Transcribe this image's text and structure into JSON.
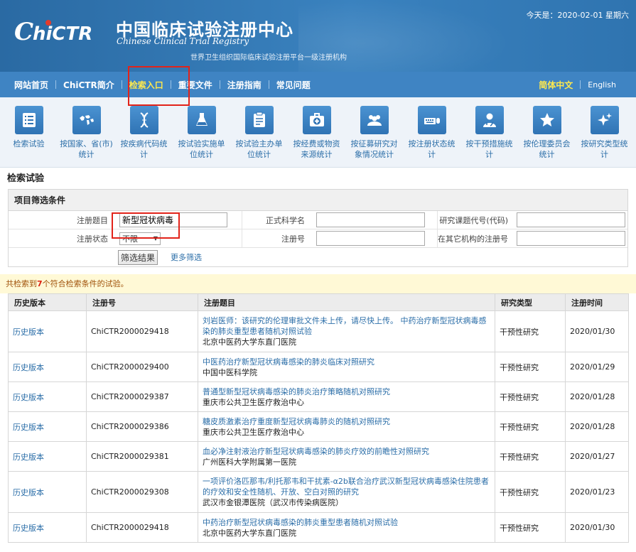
{
  "header": {
    "logo_text": "ChiCTR",
    "title_cn": "中国临床试验注册中心",
    "title_en": "Chinese Clinical Trial Registry",
    "tagline": "世界卫生组织国际临床试验注册平台一级注册机构",
    "today": "今天是：2020-02-01 星期六"
  },
  "nav": {
    "items": [
      "网站首页",
      "ChiCTR简介",
      "检索入口",
      "重要文件",
      "注册指南",
      "常见问题"
    ],
    "active_index": 2,
    "lang_cn": "简体中文",
    "lang_en": "English"
  },
  "icons": [
    {
      "label": "检索试验",
      "icon": "list-icon"
    },
    {
      "label": "按国家、省(市)统计",
      "icon": "world-map-icon"
    },
    {
      "label": "按疾病代码统计",
      "icon": "dna-icon"
    },
    {
      "label": "按试验实施单位统计",
      "icon": "flask-icon"
    },
    {
      "label": "按试验主办单位统计",
      "icon": "clipboard-icon"
    },
    {
      "label": "按经费或物资来源统计",
      "icon": "medical-kit-icon"
    },
    {
      "label": "按征募研究对象情况统计",
      "icon": "people-icon"
    },
    {
      "label": "按注册状态统计",
      "icon": "keyboard-mouse-icon"
    },
    {
      "label": "按干预措施统计",
      "icon": "doctor-icon"
    },
    {
      "label": "按伦理委员会统计",
      "icon": "star-icon"
    },
    {
      "label": "按研究类型统计",
      "icon": "sparkle-icon"
    }
  ],
  "search": {
    "section_title": "检索试验",
    "filter_title": "项目筛选条件",
    "fields": {
      "reg_title_label": "注册题目",
      "reg_title_value": "新型冠状病毒",
      "sci_name_label": "正式科学名",
      "sci_name_value": "",
      "code_label": "研究课题代号(代码)",
      "code_value": "",
      "status_label": "注册状态",
      "status_value": "不限",
      "regno_label": "注册号",
      "regno_value": "",
      "other_regno_label": "在其它机构的注册号",
      "other_regno_value": ""
    },
    "submit": "筛选结果",
    "more": "更多筛选"
  },
  "notice": {
    "prefix": "共检索到",
    "count": "7",
    "suffix": "个符合检索条件的试验。"
  },
  "table": {
    "headers": [
      "历史版本",
      "注册号",
      "注册题目",
      "研究类型",
      "注册时间"
    ],
    "rows": [
      {
        "hist": "历史版本",
        "regno": "ChiCTR2000029418",
        "title": "刘岩医师：该研究的伦理审批文件未上传，请尽快上传。 中药治疗新型冠状病毒感染的肺炎重型患者随机对照试验",
        "org": "北京中医药大学东直门医院",
        "type": "干预性研究",
        "date": "2020/01/30"
      },
      {
        "hist": "历史版本",
        "regno": "ChiCTR2000029400",
        "title": "中医药治疗新型冠状病毒感染的肺炎临床对照研究",
        "org": "中国中医科学院",
        "type": "干预性研究",
        "date": "2020/01/29"
      },
      {
        "hist": "历史版本",
        "regno": "ChiCTR2000029387",
        "title": "普通型新型冠状病毒感染的肺炎治疗策略随机对照研究",
        "org": "重庆市公共卫生医疗救治中心",
        "type": "干预性研究",
        "date": "2020/01/28"
      },
      {
        "hist": "历史版本",
        "regno": "ChiCTR2000029386",
        "title": "糖皮质激素治疗重度新型冠状病毒肺炎的随机对照研究",
        "org": "重庆市公共卫生医疗救治中心",
        "type": "干预性研究",
        "date": "2020/01/28"
      },
      {
        "hist": "历史版本",
        "regno": "ChiCTR2000029381",
        "title": "血必净注射液治疗新型冠状病毒感染的肺炎疗效的前瞻性对照研究",
        "org": "广州医科大学附属第一医院",
        "type": "干预性研究",
        "date": "2020/01/27"
      },
      {
        "hist": "历史版本",
        "regno": "ChiCTR2000029308",
        "title": "一项评价洛匹那韦/利托那韦和干扰素-α2b联合治疗武汉新型冠状病毒感染住院患者的疗效和安全性随机、开放、空白对照的研究",
        "org": "武汉市金银潭医院（武汉市传染病医院）",
        "type": "干预性研究",
        "date": "2020/01/23"
      },
      {
        "hist": "历史版本",
        "regno": "ChiCTR2000029418",
        "title": "中药治疗新型冠状病毒感染的肺炎重型患者随机对照试验",
        "org": "北京中医药大学东直门医院",
        "type": "干预性研究",
        "date": "2020/01/30"
      }
    ]
  },
  "colors": {
    "brand_blue": "#2b6ea8",
    "nav_blue": "#3f84c3",
    "highlight_red": "#e2231a",
    "active_yellow": "#ffe94d"
  }
}
